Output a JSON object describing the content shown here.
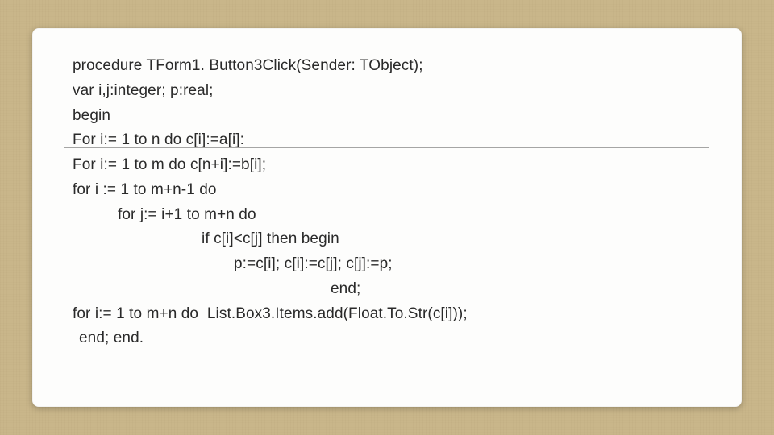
{
  "code": {
    "l1": "procedure TForm1. Button3Click(Sender: TObject);",
    "l2": "var i,j:integer; p:real;",
    "l3": "begin",
    "l4": "For i:= 1 to n do c[i]:=a[i]:",
    "l5": "For i:= 1 to m do c[n+i]:=b[i];",
    "l6": "for i := 1 to m+n-1 do",
    "l7": "for j:= i+1 to m+n do",
    "l8": "if c[i]<c[j] then begin",
    "l9": "p:=c[i]; c[i]:=c[j]; c[j]:=p;",
    "l10": "end;",
    "l11": "for i:= 1 to m+n do  List.Box3.Items.add(Float.To.Str(c[i]));",
    "l12": "end; end."
  }
}
